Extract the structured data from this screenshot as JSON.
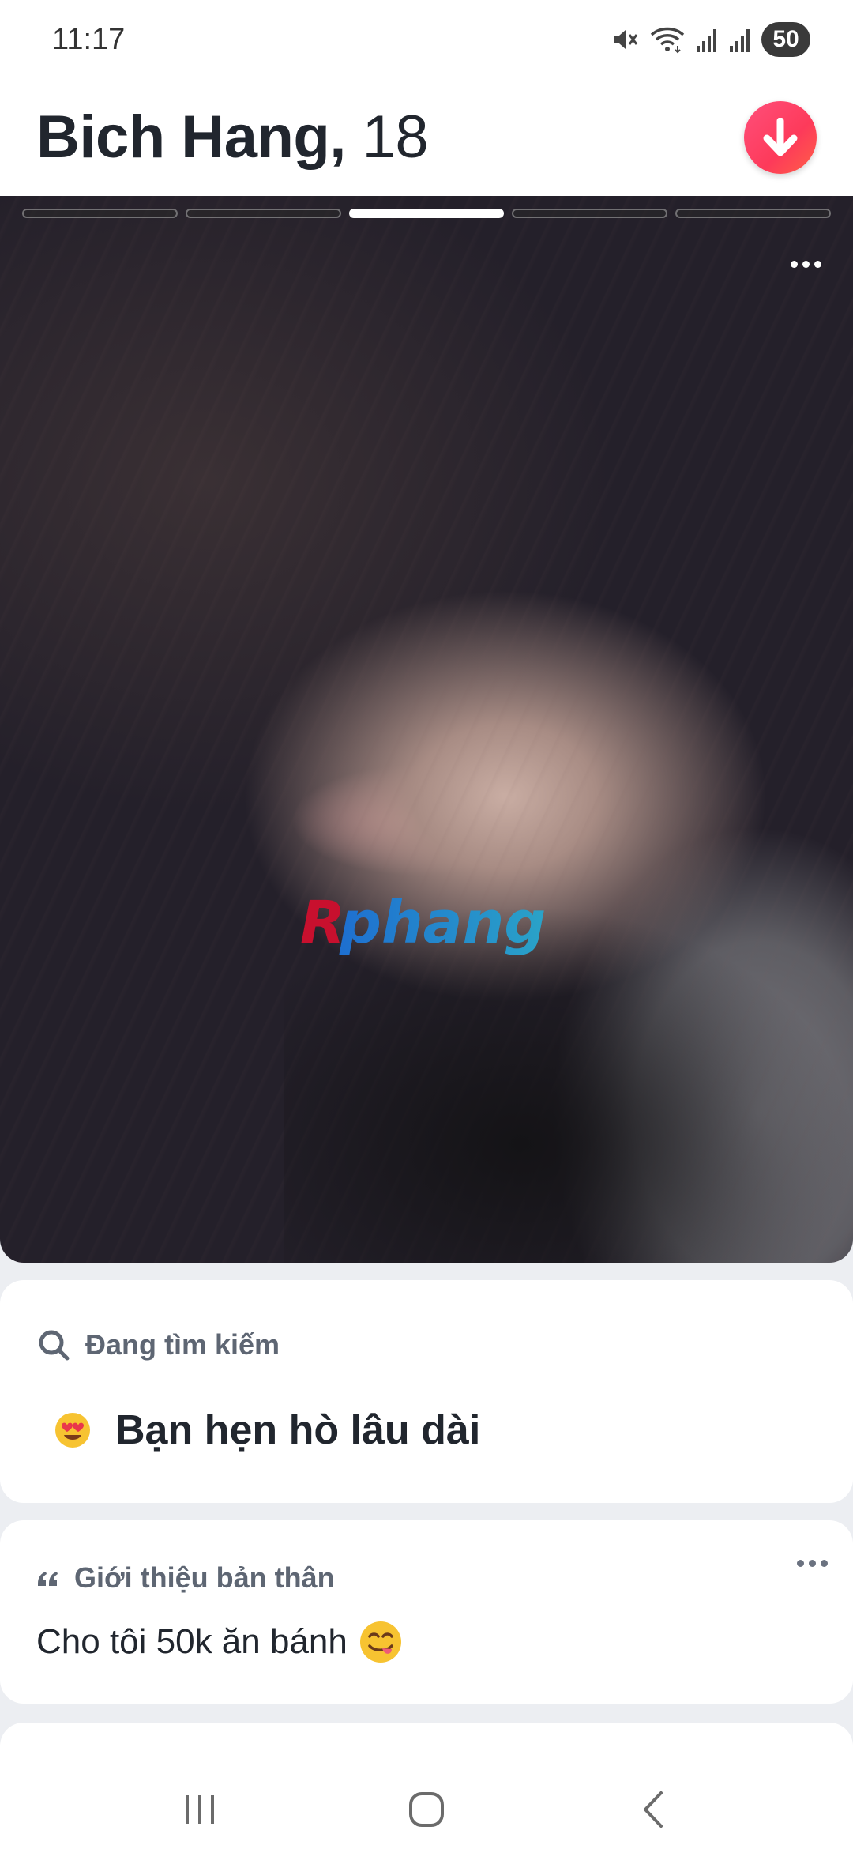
{
  "status_bar": {
    "time": "11:17",
    "battery": "50",
    "icons": [
      "mute-icon",
      "wifi-icon",
      "signal-icon",
      "signal-icon",
      "battery-icon"
    ]
  },
  "profile": {
    "name": "Bich Hang,",
    "age": "18"
  },
  "photo": {
    "photo_count": 5,
    "active_index": 2,
    "watermark": "Rphang"
  },
  "looking_for": {
    "heading": "Đang tìm kiếm",
    "value": "Bạn hẹn hò lâu dài",
    "emoji": "heart-eyes-emoji"
  },
  "about": {
    "heading": "Giới thiệu bản thân",
    "text": "Cho tôi 50k ăn bánh",
    "emoji": "yum-emoji"
  },
  "colors": {
    "accent": "#fd3a5a",
    "card_bg": "#ffffff",
    "page_bg": "#eceef2",
    "muted_text": "#5e6673"
  },
  "nav": [
    "recent-apps-icon",
    "home-icon",
    "back-icon"
  ]
}
